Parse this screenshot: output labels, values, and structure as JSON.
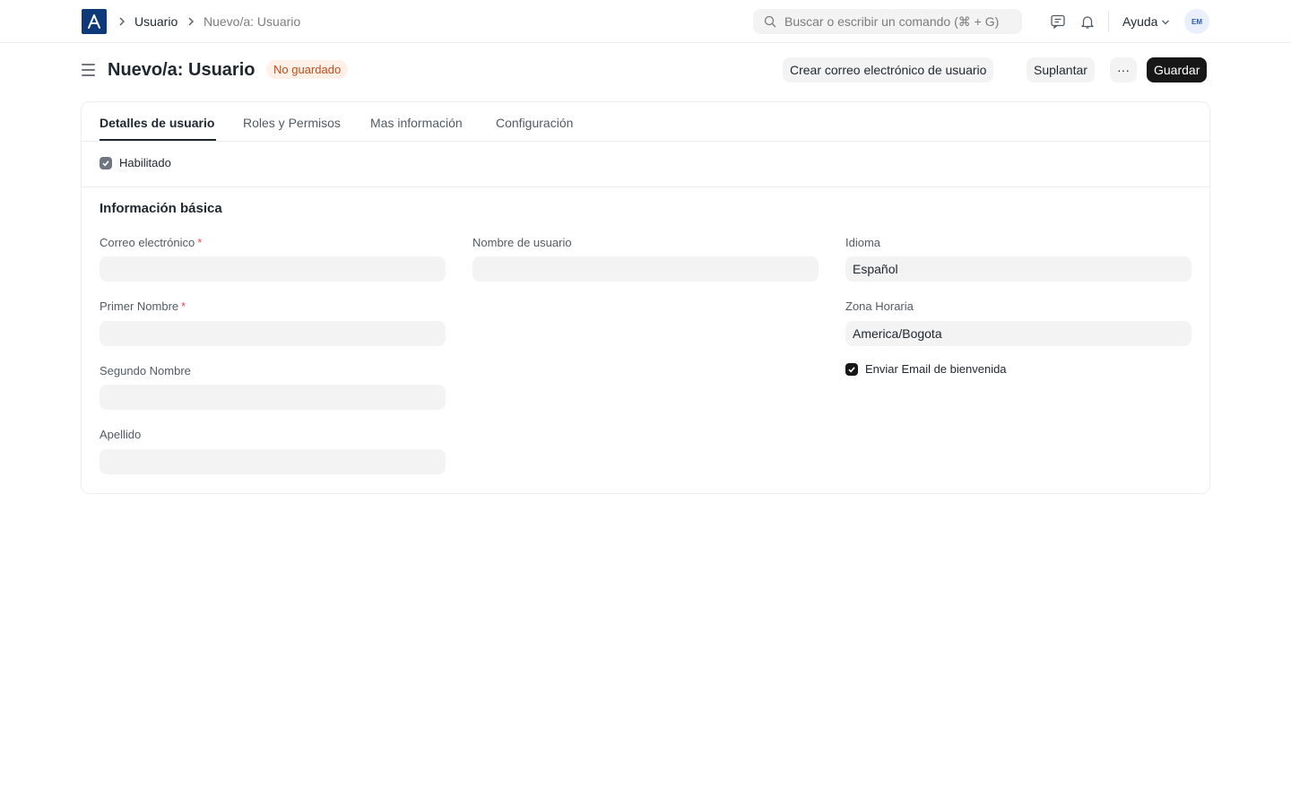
{
  "navbar": {
    "breadcrumbs": [
      "Usuario",
      "Nuevo/a: Usuario"
    ],
    "search_placeholder": "Buscar o escribir un comando (⌘ + G)",
    "help_label": "Ayuda",
    "avatar_initials": "EM"
  },
  "header": {
    "title": "Nuevo/a: Usuario",
    "status_badge": "No guardado",
    "buttons": {
      "create_email": "Crear correo electrónico de usuario",
      "impersonate": "Suplantar",
      "more": "···",
      "save": "Guardar"
    }
  },
  "tabs": [
    {
      "label": "Detalles de usuario",
      "active": true
    },
    {
      "label": "Roles y Permisos",
      "active": false
    },
    {
      "label": "Mas información",
      "active": false
    },
    {
      "label": "Configuración",
      "active": false
    }
  ],
  "form": {
    "enabled": {
      "label": "Habilitado",
      "checked": true
    },
    "section_title": "Información básica",
    "fields": {
      "email": {
        "label": "Correo electrónico",
        "required_mark": "*",
        "value": ""
      },
      "first_name": {
        "label": "Primer Nombre",
        "required_mark": "*",
        "value": ""
      },
      "middle_name": {
        "label": "Segundo Nombre",
        "value": ""
      },
      "last_name": {
        "label": "Apellido",
        "value": ""
      },
      "username": {
        "label": "Nombre de usuario",
        "value": ""
      },
      "language": {
        "label": "Idioma",
        "value": "Español"
      },
      "time_zone": {
        "label": "Zona Horaria",
        "value": "America/Bogota"
      }
    },
    "send_welcome": {
      "label": "Enviar Email de bienvenida",
      "checked": true
    }
  },
  "colors": {
    "brand": "#0f3a7a",
    "primary_button": "#171717",
    "badge_text": "#c14d1c",
    "badge_bg": "#fff1e7",
    "required": "#e24c4c"
  }
}
